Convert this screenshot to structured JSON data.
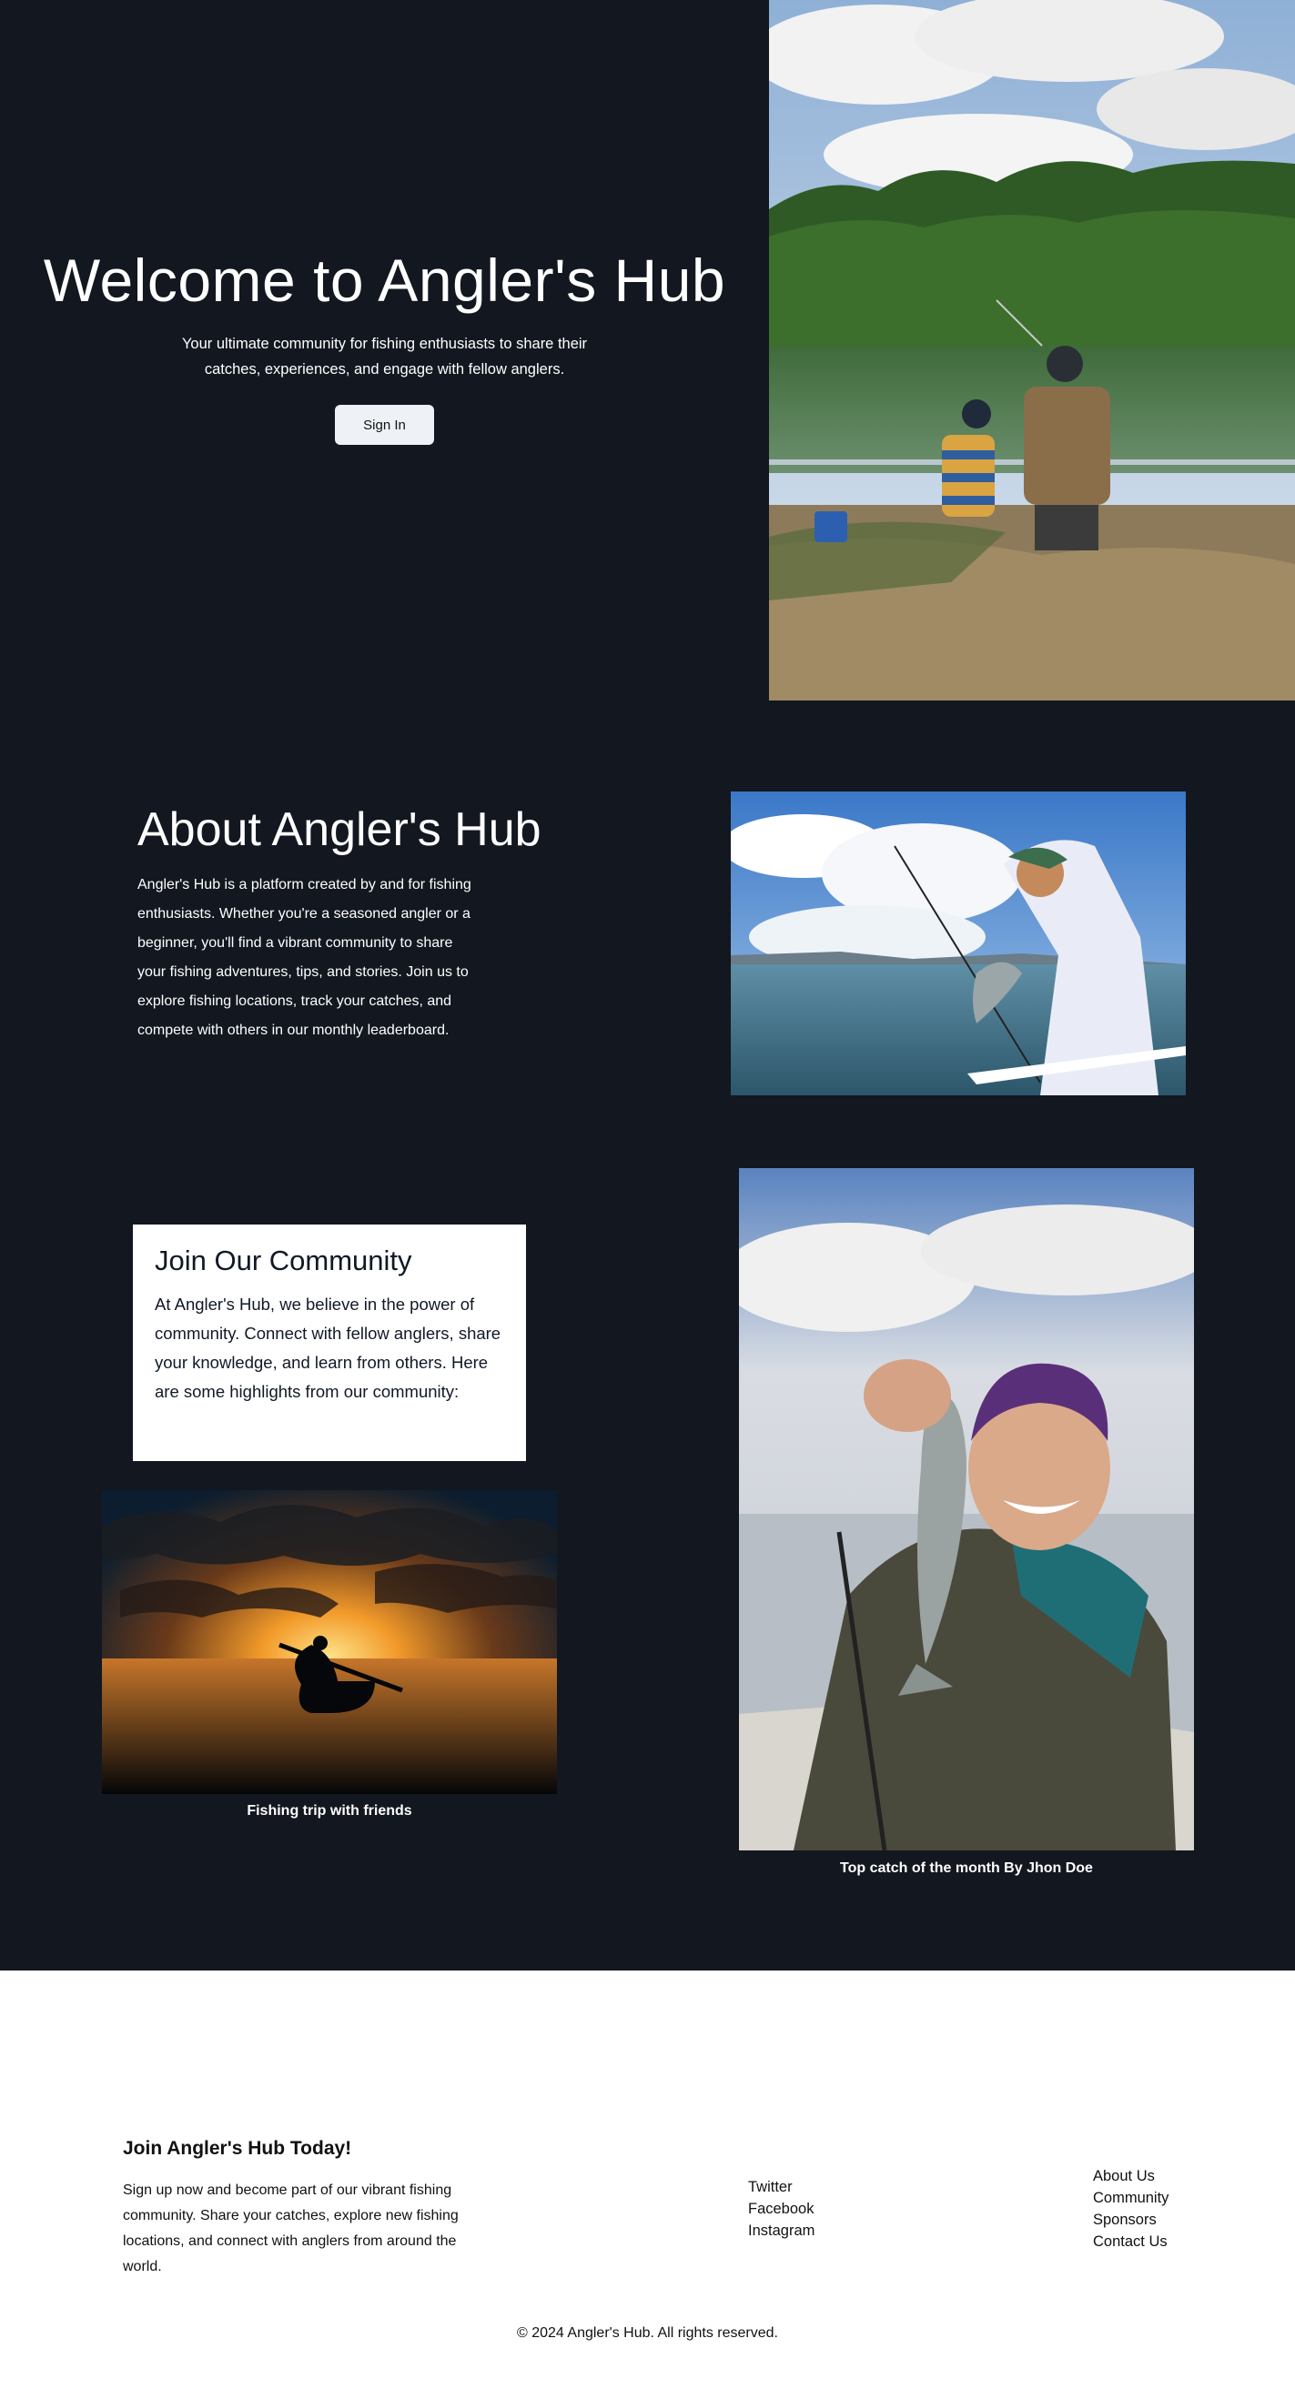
{
  "hero": {
    "title": "Welcome to Angler's Hub",
    "subtitle": "Your ultimate community for fishing enthusiasts to share their catches, experiences, and engage with fellow anglers.",
    "signin_label": "Sign In"
  },
  "about": {
    "title": "About Angler's Hub",
    "text": "Angler's Hub is a platform created by and for fishing enthusiasts. Whether you're a seasoned angler or a beginner, you'll find a vibrant community to share your fishing adventures, tips, and stories. Join us to explore fishing locations, track your catches, and compete with others in our monthly leaderboard."
  },
  "community": {
    "title": "Join Our Community",
    "text": "At Angler's Hub, we believe in the power of community. Connect with fellow anglers, share your knowledge, and learn from others. Here are some highlights from our community:",
    "highlights": [
      {
        "caption": "Fishing trip with friends"
      },
      {
        "caption": "Top catch of the month By Jhon Doe"
      }
    ]
  },
  "footer": {
    "title": "Join Angler's Hub Today!",
    "text": "Sign up now and become part of our vibrant fishing community. Share your catches, explore new fishing locations, and connect with anglers from around the world.",
    "social_links": [
      "Twitter",
      "Facebook",
      "Instagram"
    ],
    "site_links": [
      "About Us",
      "Community",
      "Sponsors",
      "Contact Us"
    ],
    "copyright": "© 2024 Angler's Hub. All rights reserved."
  }
}
